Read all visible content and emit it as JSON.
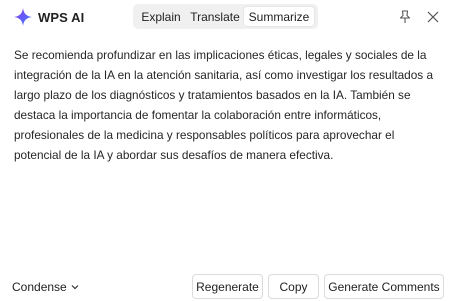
{
  "brand": {
    "name": "WPS AI",
    "logo_icon": "sparkle-icon"
  },
  "tabs": [
    {
      "label": "Explain",
      "active": false
    },
    {
      "label": "Translate",
      "active": false
    },
    {
      "label": "Summarize",
      "active": true
    }
  ],
  "header_icons": {
    "pin": "pin-icon",
    "close": "close-icon"
  },
  "summary": {
    "text": "Se recomienda profundizar en las implicaciones éticas, legales y sociales de la integración de la IA en la atención sanitaria, así como investigar los resultados a largo plazo de los diagnósticos y tratamientos basados en la IA. También se destaca la importancia de fomentar la colaboración entre informáticos, profesionales de la medicina y responsables políticos para aprovechar el potencial de la IA y abordar sus desafíos de manera efectiva."
  },
  "footer": {
    "length_selector": "Condense",
    "regenerate_label": "Regenerate",
    "copy_label": "Copy",
    "generate_comments_label": "Generate Comments"
  },
  "colors": {
    "logo_gradient_start": "#7b3cf5",
    "logo_gradient_end": "#4a7bff",
    "tab_bar_bg": "#f0f0f0",
    "text": "#262626"
  }
}
